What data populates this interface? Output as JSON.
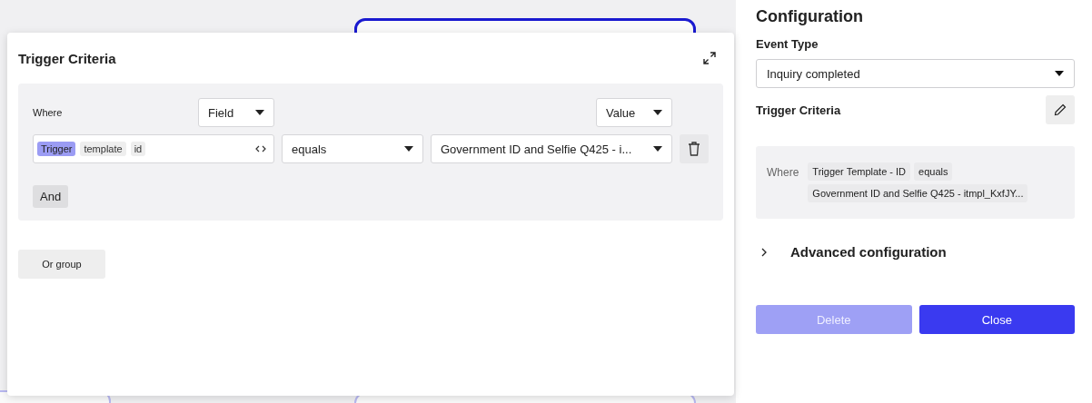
{
  "modal": {
    "title": "Trigger Criteria",
    "where_label": "Where",
    "field_select": "Field",
    "value_select": "Value",
    "condition": {
      "chips": [
        {
          "label": "Trigger",
          "selected": true
        },
        {
          "label": "template",
          "selected": false
        },
        {
          "label": "id",
          "selected": false
        }
      ],
      "operator": "equals",
      "value": "Government ID and Selfie Q425 - i..."
    },
    "and_button": "And",
    "or_group_button": "Or group"
  },
  "panel": {
    "title": "Configuration",
    "event_type_label": "Event Type",
    "event_type_value": "Inquiry completed",
    "trigger_criteria_label": "Trigger Criteria",
    "summary": {
      "where_label": "Where",
      "tags": [
        "Trigger Template - ID",
        "equals",
        "Government ID and Selfie Q425 - itmpl_KxfJY..."
      ]
    },
    "advanced": {
      "label": "Advanced configuration",
      "expanded": false
    },
    "buttons": [
      {
        "label": "Delete",
        "kind": "secondary",
        "disabled": true
      },
      {
        "label": "Close",
        "kind": "primary",
        "disabled": false
      }
    ]
  }
}
